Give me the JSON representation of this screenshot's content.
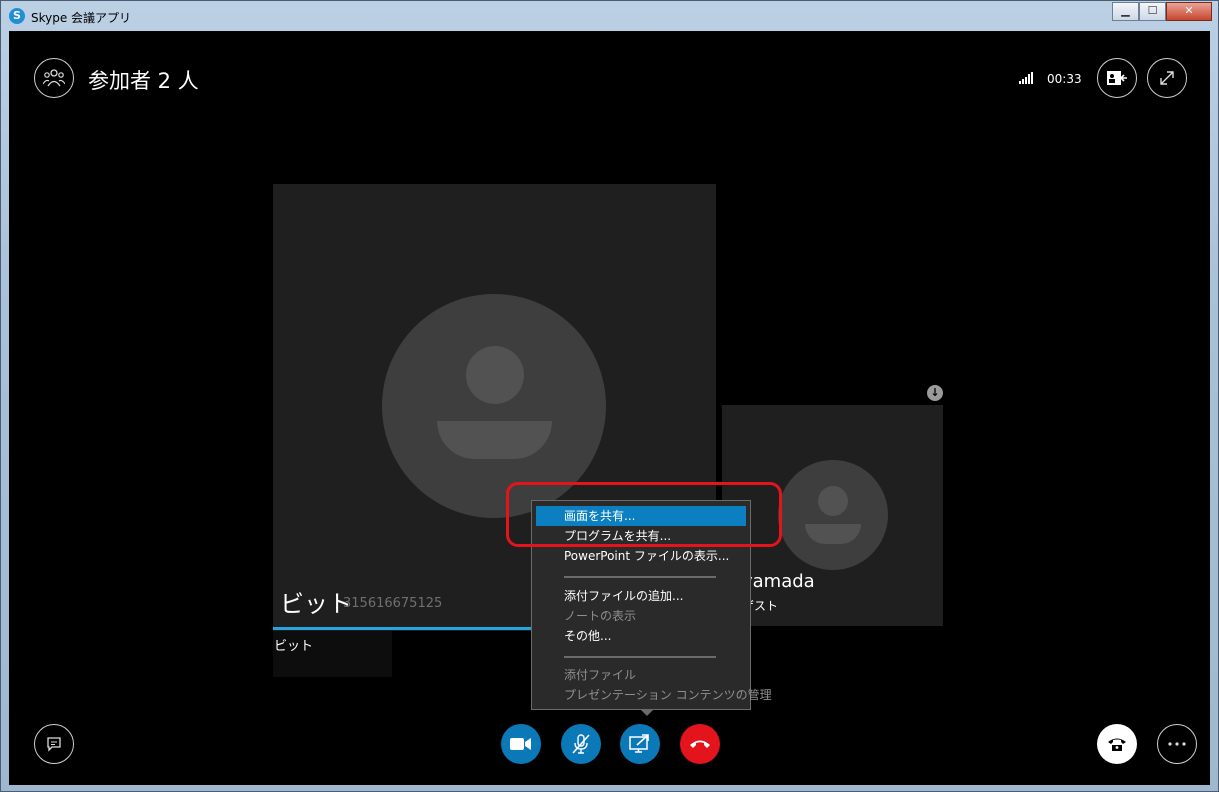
{
  "window": {
    "title": "Skype 会議アプリ",
    "logo_letter": "S",
    "minimize": "▁",
    "maximize": "☐",
    "close": "✕"
  },
  "header": {
    "title": "参加者 2 人",
    "timer": "00:33"
  },
  "participants": {
    "main": {
      "name": "ビット",
      "id_overlay": "315616675125",
      "label": "ビット"
    },
    "secondary": {
      "name": "yamada",
      "role": "ゲスト"
    }
  },
  "share_menu": {
    "items": [
      {
        "label": "画面を共有...",
        "state": "selected"
      },
      {
        "label": "プログラムを共有...",
        "state": "enabled"
      },
      {
        "label": "PowerPoint ファイルの表示...",
        "state": "enabled"
      },
      {
        "label": "添付ファイルの追加...",
        "state": "enabled"
      },
      {
        "label": "ノートの表示",
        "state": "disabled"
      },
      {
        "label": "その他...",
        "state": "enabled"
      },
      {
        "label": "添付ファイル",
        "state": "disabled"
      },
      {
        "label": "プレゼンテーション コンテンツの管理",
        "state": "disabled"
      }
    ]
  },
  "colors": {
    "accent": "#0b79b8",
    "hangup": "#e3141b",
    "annotation": "#e3141b",
    "selection": "#0b7fbf"
  },
  "icons": [
    "people-icon",
    "signal-icon",
    "contact-card-icon",
    "expand-icon",
    "chat-icon",
    "video-icon",
    "mic-muted-icon",
    "share-screen-icon",
    "hangup-icon",
    "dialpad-phone-icon",
    "more-icon",
    "download-icon"
  ]
}
